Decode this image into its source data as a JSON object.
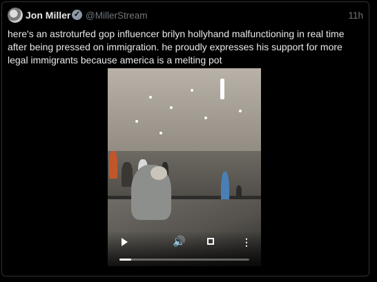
{
  "tweet": {
    "author_name": "Jon Miller",
    "handle": "@MillerStream",
    "time": "11h",
    "verified_mark": "✓",
    "text_lines": [
      "here's an astroturfed gop influencer brilyn hollyhand malfunctioning in real time",
      "after being pressed on immigration. he proudly expresses his support for more",
      "legal immigrants because america is a melting pot"
    ]
  },
  "video": {
    "controls": {
      "play_icon": "play-icon",
      "volume_icon": "volume-icon",
      "volume_glyph": "🔊",
      "fullscreen_icon": "fullscreen-icon",
      "more_icon": "more-options-icon",
      "more_glyph": "⋮"
    },
    "progress": 0.09
  },
  "colors": {
    "background": "#000000",
    "text": "#e7e9ea",
    "secondary_text": "#71767b",
    "border": "#2f3336"
  }
}
